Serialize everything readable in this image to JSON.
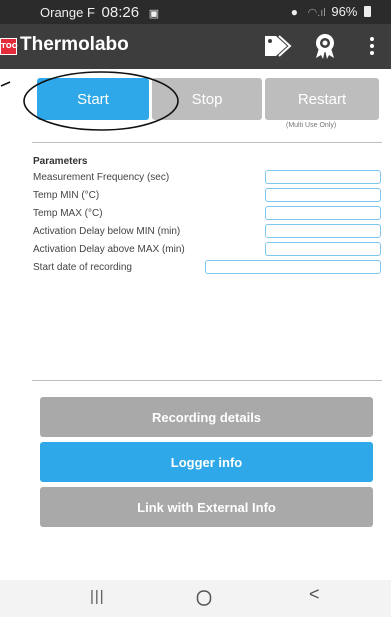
{
  "status_bar": {
    "carrier": "Orange F",
    "time": "08:26",
    "battery": "96%"
  },
  "app_bar": {
    "logo_text": "TOO",
    "title": "Thermolabo",
    "icons": [
      "tag-icon",
      "award-icon",
      "more-vert-icon"
    ]
  },
  "actions": {
    "start_label": "Start",
    "stop_label": "Stop",
    "restart_label": "Restart",
    "restart_note": "(Multi Use Only)"
  },
  "parameters": {
    "title": "Parameters",
    "fields": [
      {
        "label": "Measurement Frequency (sec)",
        "value": ""
      },
      {
        "label": "Temp MIN (°C)",
        "value": ""
      },
      {
        "label": "Temp MAX (°C)",
        "value": ""
      },
      {
        "label": "Activation Delay below MIN (min)",
        "value": ""
      },
      {
        "label": "Activation Delay above MAX (min)",
        "value": ""
      },
      {
        "label": "Start date of recording",
        "value": ""
      }
    ]
  },
  "buttons": {
    "recording_details": "Recording details",
    "logger_info": "Logger info",
    "link_external": "Link with External Info"
  },
  "nav": {
    "recents_glyph": "|||",
    "back_glyph": "<"
  },
  "colors": {
    "accent": "#2ea8e8",
    "disabled": "#bdbdbd",
    "appbar": "#3d3d3d",
    "statusbar": "#2b2b2b"
  }
}
